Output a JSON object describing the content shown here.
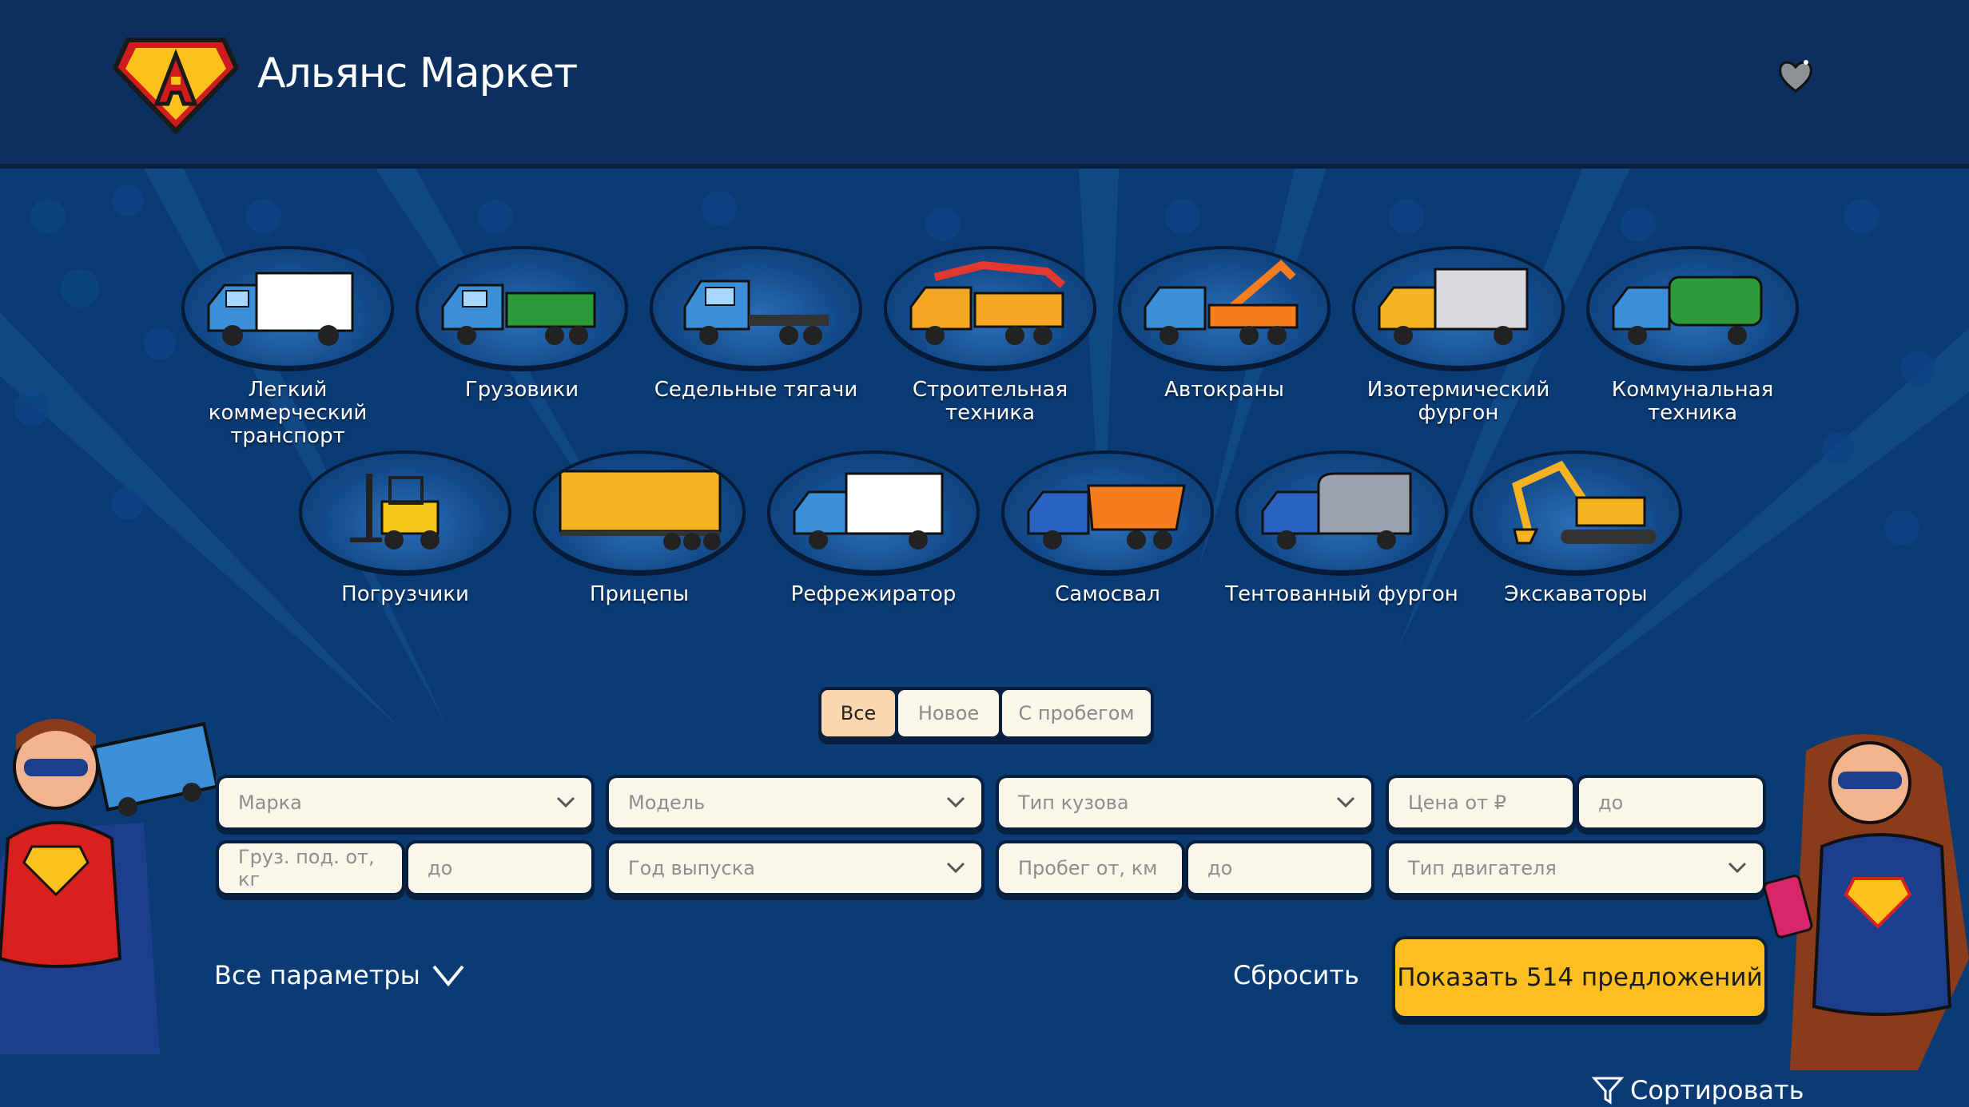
{
  "header": {
    "brand": "Альянс Маркет",
    "logo_letter": "A",
    "favorites_icon": "heart-icon"
  },
  "categories": [
    {
      "label": "Легкий коммерческий транспорт",
      "icon": "light-commercial-truck-icon",
      "accent": "#ffffff"
    },
    {
      "label": "Грузовики",
      "icon": "flatbed-truck-icon",
      "accent": "#2e9b3a"
    },
    {
      "label": "Седельные тягачи",
      "icon": "tractor-unit-icon",
      "accent": "#2f7dd1"
    },
    {
      "label": "Строительная техника",
      "icon": "concrete-pump-icon",
      "accent": "#f5a623"
    },
    {
      "label": "Автокраны",
      "icon": "tow-crane-icon",
      "accent": "#f57c1f"
    },
    {
      "label": "Изотермический фургон",
      "icon": "isothermal-van-icon",
      "accent": "#f5b323"
    },
    {
      "label": "Коммунальная техника",
      "icon": "street-sweeper-icon",
      "accent": "#2e9b3a"
    },
    {
      "label": "Погрузчики",
      "icon": "forklift-icon",
      "accent": "#f5c518"
    },
    {
      "label": "Прицепы",
      "icon": "trailer-icon",
      "accent": "#f5b323"
    },
    {
      "label": "Рефрежиратор",
      "icon": "refrigerator-truck-icon",
      "accent": "#ffffff"
    },
    {
      "label": "Самосвал",
      "icon": "dump-truck-icon",
      "accent": "#f57c1f"
    },
    {
      "label": "Тентованный фургон",
      "icon": "tent-van-icon",
      "accent": "#9aa3ad"
    },
    {
      "label": "Экскаваторы",
      "icon": "excavator-icon",
      "accent": "#f5b323"
    }
  ],
  "condition": {
    "options": [
      "Все",
      "Новое",
      "С пробегом"
    ],
    "selected": "Все"
  },
  "filters": {
    "brand": "Марка",
    "model": "Модель",
    "body_type": "Тип кузова",
    "price_from": "Цена от ₽",
    "price_to": "до",
    "payload_from": "Груз. под. от, кг",
    "payload_to": "до",
    "year": "Год выпуска",
    "mileage_from": "Пробег от, км",
    "mileage_to": "до",
    "engine_type": "Тип двигателя"
  },
  "actions": {
    "all_params": "Все параметры",
    "reset": "Сбросить",
    "show": "Показать 514 предложений",
    "sort": "Сортировать"
  },
  "colors": {
    "header_bg": "#0b2f5e",
    "page_bg": "#0a3b74",
    "accent_yellow": "#fdbf1f",
    "selected_toggle": "#fcd7ad",
    "field_bg": "#fbf6ea"
  }
}
